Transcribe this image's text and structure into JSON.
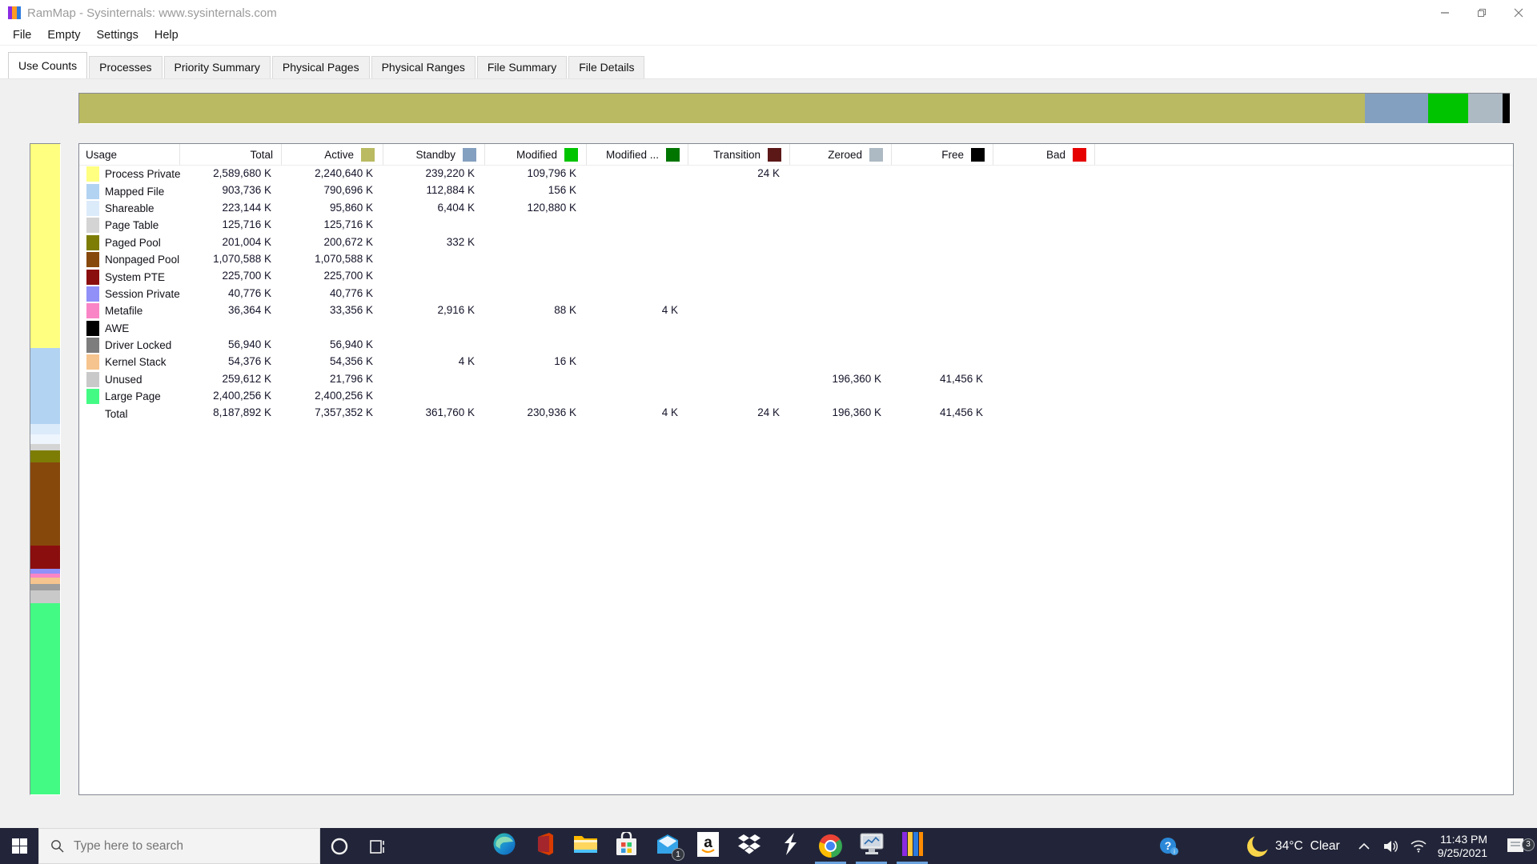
{
  "window": {
    "title": "RamMap - Sysinternals: www.sysinternals.com",
    "controls": {
      "minimize": "minimize",
      "restore": "restore",
      "close": "close"
    }
  },
  "menu": {
    "items": [
      "File",
      "Empty",
      "Settings",
      "Help"
    ]
  },
  "tabs": {
    "active": "Use Counts",
    "items": [
      "Use Counts",
      "Processes",
      "Priority Summary",
      "Physical Pages",
      "Physical Ranges",
      "File Summary",
      "File Details"
    ]
  },
  "colors": {
    "active": "#b9ba62",
    "standby": "#84a0c0",
    "modified": "#00c400",
    "modified_no_write": "#007500",
    "transition": "#5c1717",
    "zeroed": "#adb9c3",
    "free": "#000000",
    "bad": "#e60000",
    "taskbar": "#222539",
    "running_underline": "#6ba2dd"
  },
  "memory_bar": {
    "segments": [
      {
        "name": "active",
        "color": "#b9ba62",
        "pct": 89.85
      },
      {
        "name": "standby",
        "color": "#84a0c0",
        "pct": 4.42
      },
      {
        "name": "modified",
        "color": "#00c400",
        "pct": 2.82
      },
      {
        "name": "zeroed",
        "color": "#adb9c3",
        "pct": 2.4
      },
      {
        "name": "free",
        "color": "#000000",
        "pct": 0.51
      }
    ]
  },
  "side_bar": {
    "segments": [
      {
        "name": "process-private",
        "color": "#ffff80",
        "pct": 31.4
      },
      {
        "name": "mapped-file",
        "color": "#b2d3f2",
        "pct": 11.6
      },
      {
        "name": "shareable",
        "color": "#dcebfa",
        "pct": 1.7
      },
      {
        "name": "shareable-standby",
        "color": "#eef5fd",
        "pct": 1.4
      },
      {
        "name": "page-table",
        "color": "#d4d4d4",
        "pct": 1.0
      },
      {
        "name": "paged-pool",
        "color": "#7d7d05",
        "pct": 1.9
      },
      {
        "name": "nonpaged-pool",
        "color": "#87480b",
        "pct": 12.8
      },
      {
        "name": "system-pte",
        "color": "#8b0e0e",
        "pct": 3.5
      },
      {
        "name": "session-private",
        "color": "#9090f8",
        "pct": 0.8
      },
      {
        "name": "metafile",
        "color": "#f985c6",
        "pct": 0.6
      },
      {
        "name": "kernel-stack",
        "color": "#f6c48e",
        "pct": 0.9
      },
      {
        "name": "driver-locked",
        "color": "#9e9e9e",
        "pct": 1.0
      },
      {
        "name": "unused",
        "color": "#c9c9c9",
        "pct": 2.0
      },
      {
        "name": "large-page",
        "color": "#43fb84",
        "pct": 29.4
      }
    ]
  },
  "table": {
    "columns": [
      {
        "label": "Usage"
      },
      {
        "label": "Total"
      },
      {
        "label": "Active",
        "swatch": "#b9ba62"
      },
      {
        "label": "Standby",
        "swatch": "#84a0c0"
      },
      {
        "label": "Modified",
        "swatch": "#00c400"
      },
      {
        "label": "Modified ...",
        "swatch": "#007500"
      },
      {
        "label": "Transition",
        "swatch": "#5c1717"
      },
      {
        "label": "Zeroed",
        "swatch": "#adb9c3"
      },
      {
        "label": "Free",
        "swatch": "#000000"
      },
      {
        "label": "Bad",
        "swatch": "#e60000"
      }
    ],
    "rows": [
      {
        "label": "Process Private",
        "swatch": "#ffff80",
        "values": [
          "2,589,680 K",
          "2,240,640 K",
          "239,220 K",
          "109,796 K",
          "",
          "24 K",
          "",
          "",
          ""
        ]
      },
      {
        "label": "Mapped File",
        "swatch": "#b2d3f2",
        "values": [
          "903,736 K",
          "790,696 K",
          "112,884 K",
          "156 K",
          "",
          "",
          "",
          "",
          ""
        ]
      },
      {
        "label": "Shareable",
        "swatch": "#dcebfa",
        "values": [
          "223,144 K",
          "95,860 K",
          "6,404 K",
          "120,880 K",
          "",
          "",
          "",
          "",
          ""
        ]
      },
      {
        "label": "Page Table",
        "swatch": "#d4d4d4",
        "values": [
          "125,716 K",
          "125,716 K",
          "",
          "",
          "",
          "",
          "",
          "",
          ""
        ]
      },
      {
        "label": "Paged Pool",
        "swatch": "#7d7d05",
        "values": [
          "201,004 K",
          "200,672 K",
          "332 K",
          "",
          "",
          "",
          "",
          "",
          ""
        ]
      },
      {
        "label": "Nonpaged Pool",
        "swatch": "#87480b",
        "values": [
          "1,070,588 K",
          "1,070,588 K",
          "",
          "",
          "",
          "",
          "",
          "",
          ""
        ]
      },
      {
        "label": "System PTE",
        "swatch": "#8b0e0e",
        "values": [
          "225,700 K",
          "225,700 K",
          "",
          "",
          "",
          "",
          "",
          "",
          ""
        ]
      },
      {
        "label": "Session Private",
        "swatch": "#9090f8",
        "values": [
          "40,776 K",
          "40,776 K",
          "",
          "",
          "",
          "",
          "",
          "",
          ""
        ]
      },
      {
        "label": "Metafile",
        "swatch": "#f985c6",
        "values": [
          "36,364 K",
          "33,356 K",
          "2,916 K",
          "88 K",
          "4 K",
          "",
          "",
          "",
          ""
        ]
      },
      {
        "label": "AWE",
        "swatch": "#000000",
        "values": [
          "",
          "",
          "",
          "",
          "",
          "",
          "",
          "",
          ""
        ]
      },
      {
        "label": "Driver Locked",
        "swatch": "#7d7d7d",
        "values": [
          "56,940 K",
          "56,940 K",
          "",
          "",
          "",
          "",
          "",
          "",
          ""
        ]
      },
      {
        "label": "Kernel Stack",
        "swatch": "#f6c48e",
        "values": [
          "54,376 K",
          "54,356 K",
          "4 K",
          "16 K",
          "",
          "",
          "",
          "",
          ""
        ]
      },
      {
        "label": "Unused",
        "swatch": "#c9c9c9",
        "values": [
          "259,612 K",
          "21,796 K",
          "",
          "",
          "",
          "",
          "196,360 K",
          "41,456 K",
          ""
        ]
      },
      {
        "label": "Large Page",
        "swatch": "#43fb84",
        "values": [
          "2,400,256 K",
          "2,400,256 K",
          "",
          "",
          "",
          "",
          "",
          "",
          ""
        ]
      },
      {
        "label": "Total",
        "total": true,
        "values": [
          "8,187,892 K",
          "7,357,352 K",
          "361,760 K",
          "230,936 K",
          "4 K",
          "24 K",
          "196,360 K",
          "41,456 K",
          ""
        ]
      }
    ]
  },
  "taskbar": {
    "search_placeholder": "Type here to search",
    "apps": [
      {
        "name": "edge"
      },
      {
        "name": "office"
      },
      {
        "name": "file-explorer"
      },
      {
        "name": "store"
      },
      {
        "name": "mail",
        "badge": "1"
      },
      {
        "name": "amazon"
      },
      {
        "name": "dropbox"
      },
      {
        "name": "sysinternals"
      },
      {
        "name": "chrome",
        "running": true
      },
      {
        "name": "perfmon",
        "running": true
      },
      {
        "name": "rammap",
        "running": true
      }
    ],
    "tray": {
      "weather_temp": "34°C",
      "weather_cond": "Clear",
      "time": "11:43 PM",
      "date": "9/25/2021",
      "notification_count": "3"
    }
  }
}
